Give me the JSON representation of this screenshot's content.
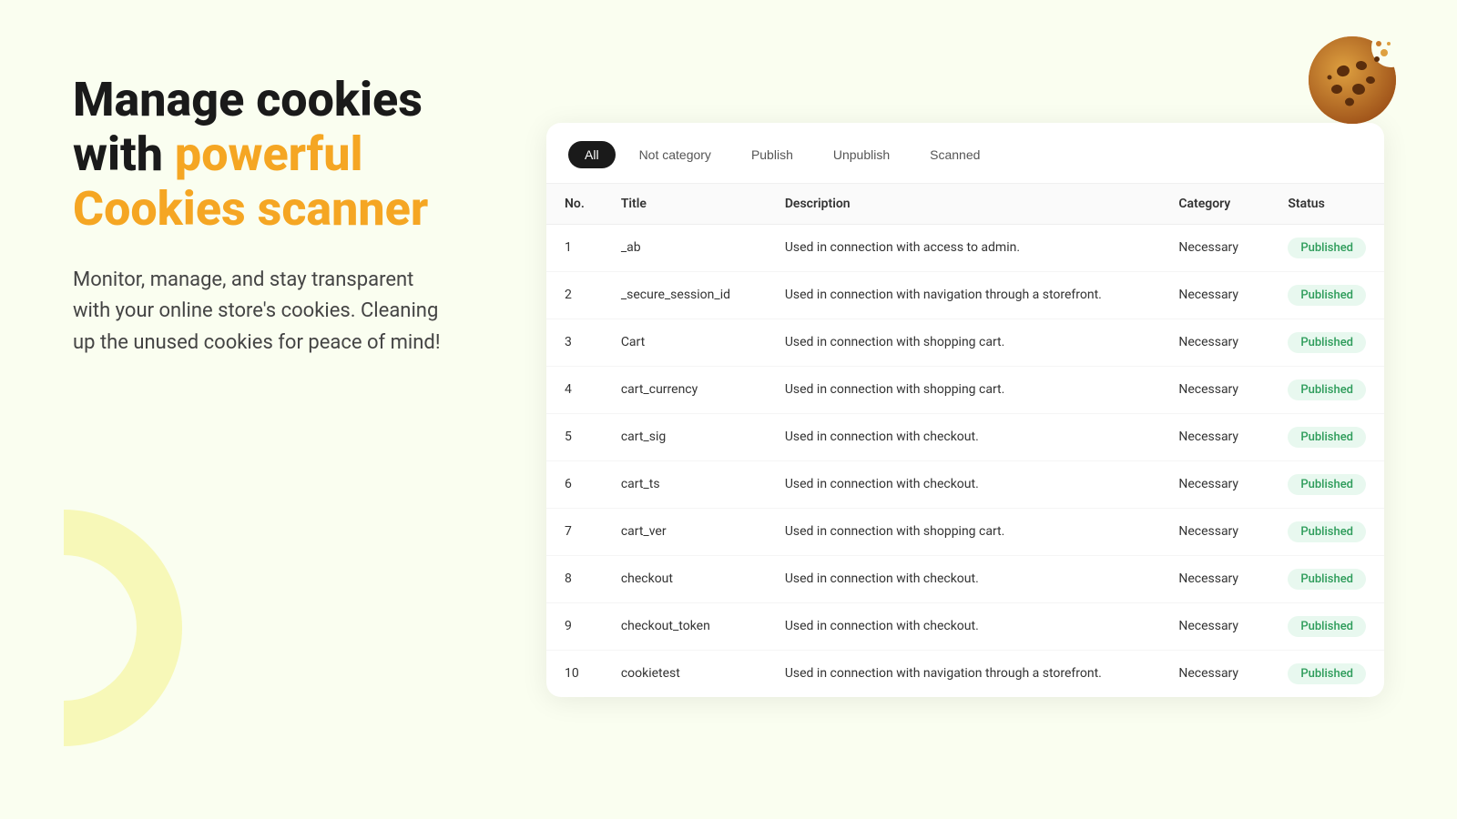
{
  "left": {
    "headline_line1": "Manage cookies",
    "headline_line2": "with ",
    "headline_accent": "powerful",
    "headline_line3": "Cookies scanner",
    "subtitle": "Monitor, manage, and stay transparent with your online store's cookies. Cleaning up the unused cookies for peace of mind!"
  },
  "filter_tabs": [
    {
      "label": "All",
      "active": true
    },
    {
      "label": "Not category",
      "active": false
    },
    {
      "label": "Publish",
      "active": false
    },
    {
      "label": "Unpublish",
      "active": false
    },
    {
      "label": "Scanned",
      "active": false
    }
  ],
  "table": {
    "columns": [
      "No.",
      "Title",
      "Description",
      "Category",
      "Status"
    ],
    "rows": [
      {
        "no": 1,
        "title": "_ab",
        "description": "Used in connection with access to admin.",
        "category": "Necessary",
        "status": "Published"
      },
      {
        "no": 2,
        "title": "_secure_session_id",
        "description": "Used in connection with navigation through a storefront.",
        "category": "Necessary",
        "status": "Published"
      },
      {
        "no": 3,
        "title": "Cart",
        "description": "Used in connection with shopping cart.",
        "category": "Necessary",
        "status": "Published"
      },
      {
        "no": 4,
        "title": "cart_currency",
        "description": "Used in connection with shopping cart.",
        "category": "Necessary",
        "status": "Published"
      },
      {
        "no": 5,
        "title": "cart_sig",
        "description": "Used in connection with checkout.",
        "category": "Necessary",
        "status": "Published"
      },
      {
        "no": 6,
        "title": "cart_ts",
        "description": "Used in connection with checkout.",
        "category": "Necessary",
        "status": "Published"
      },
      {
        "no": 7,
        "title": "cart_ver",
        "description": "Used in connection with shopping cart.",
        "category": "Necessary",
        "status": "Published"
      },
      {
        "no": 8,
        "title": "checkout",
        "description": "Used in connection with checkout.",
        "category": "Necessary",
        "status": "Published"
      },
      {
        "no": 9,
        "title": "checkout_token",
        "description": "Used in connection with checkout.",
        "category": "Necessary",
        "status": "Published"
      },
      {
        "no": 10,
        "title": "cookietest",
        "description": "Used in connection with navigation through a storefront.",
        "category": "Necessary",
        "status": "Published"
      }
    ]
  },
  "colors": {
    "accent": "#f5a623",
    "published_bg": "#e8f8ef",
    "published_text": "#2d9c5a",
    "active_tab_bg": "#1a1a1a",
    "active_tab_text": "#ffffff"
  }
}
